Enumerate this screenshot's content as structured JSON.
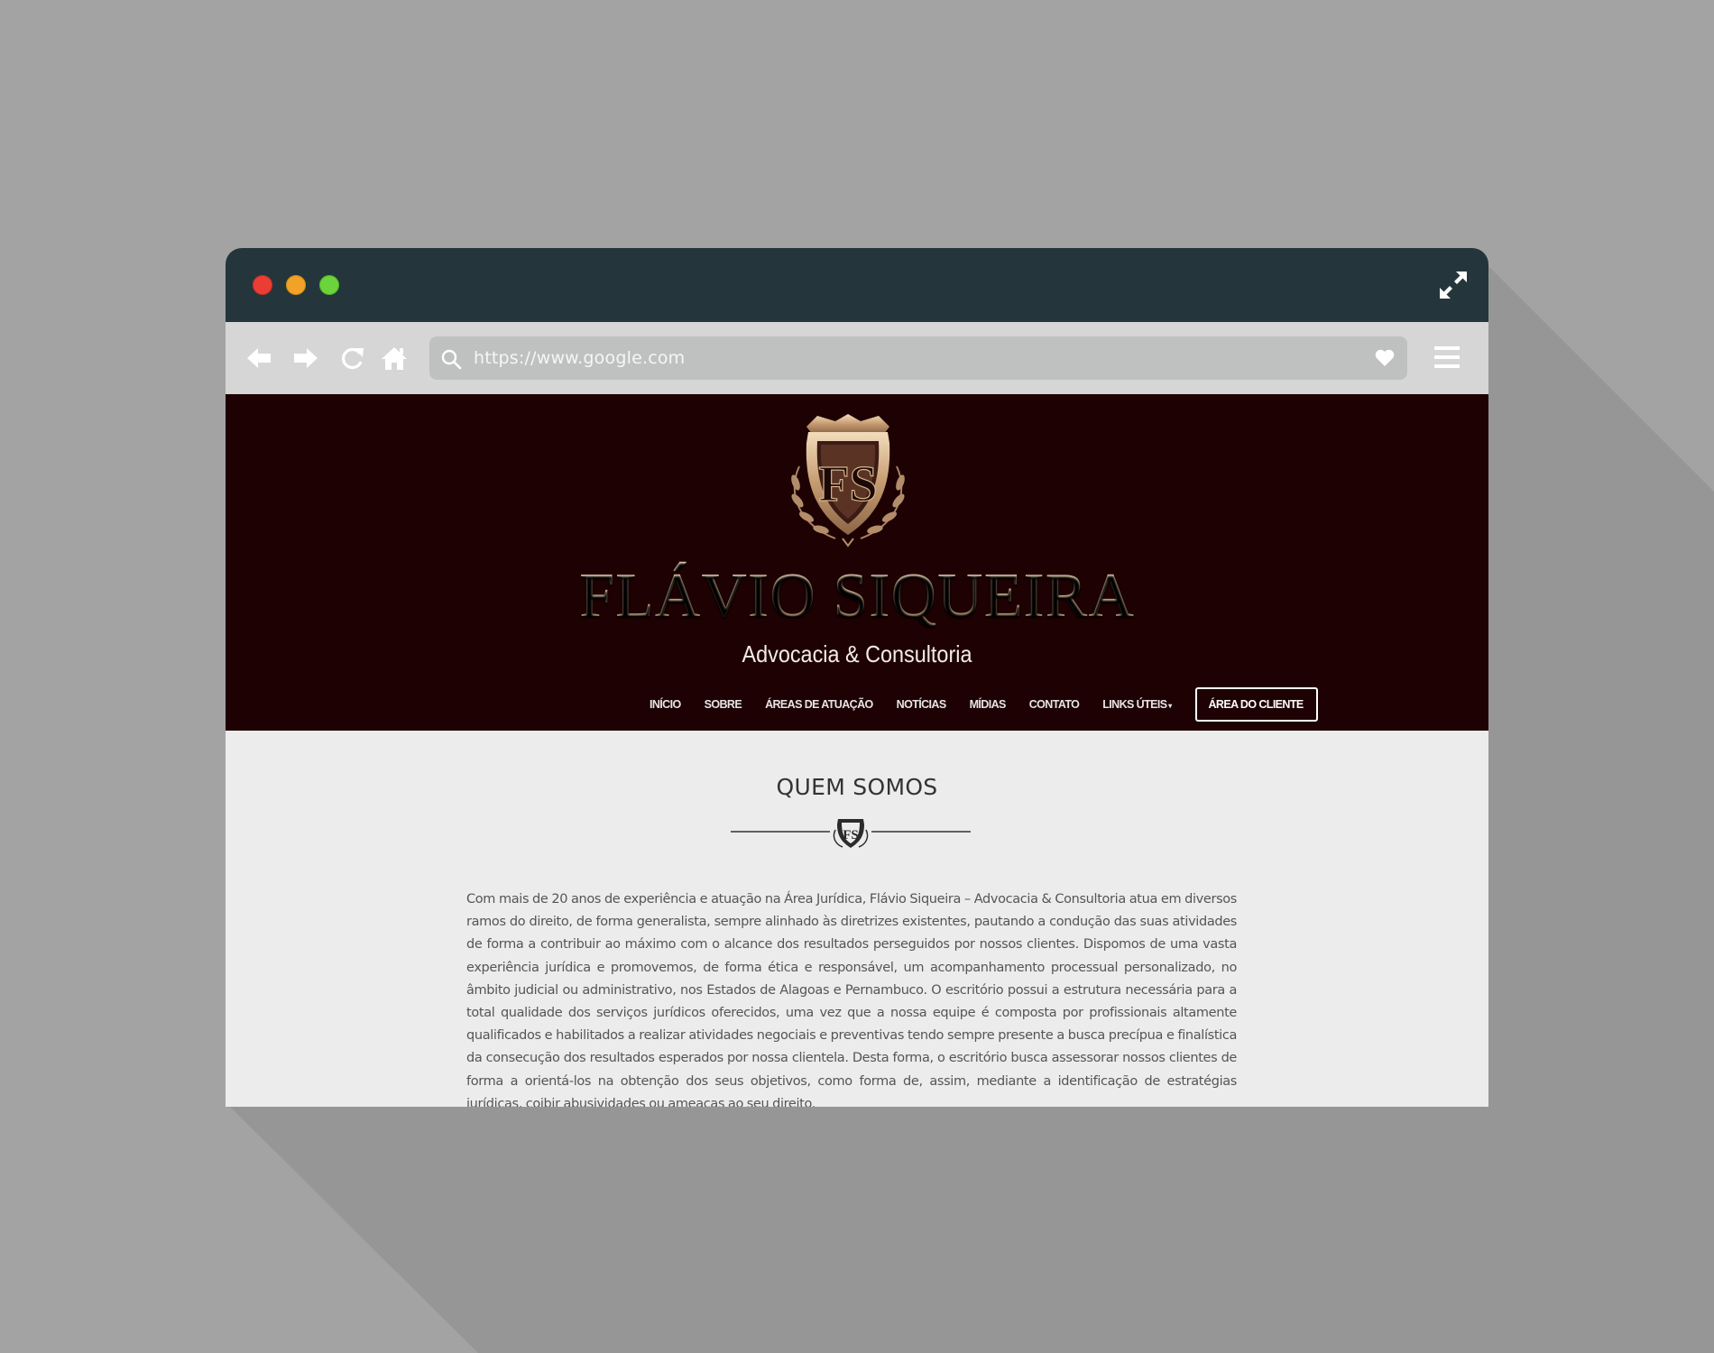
{
  "browser": {
    "url": "https://www.google.com"
  },
  "site": {
    "brand_name": "FLÁVIO SIQUEIRA",
    "brand_subtitle": "Advocacia & Consultoria",
    "logo_monogram": "FS",
    "nav": [
      {
        "label": "INÍCIO"
      },
      {
        "label": "SOBRE"
      },
      {
        "label": "ÁREAS DE ATUAÇÃO"
      },
      {
        "label": "NOTÍCIAS"
      },
      {
        "label": "MÍDIAS"
      },
      {
        "label": "CONTATO"
      },
      {
        "label": "LINKS ÚTEIS"
      }
    ],
    "cta_label": "ÁREA DO CLIENTE"
  },
  "section": {
    "title": "QUEM SOMOS",
    "body": "Com mais de 20 anos de experiência e atuação na Área Jurídica, Flávio Siqueira – Advocacia & Consultoria atua em diversos ramos do direito, de forma generalista, sempre alinhado às diretrizes existentes, pautando a condução das suas atividades de forma a contribuir ao máximo com o alcance dos resultados perseguidos por nossos clientes. Dispomos de uma vasta experiência jurídica e promovemos, de forma ética e responsável, um acompanhamento processual personalizado, no âmbito judicial ou administrativo, nos Estados de Alagoas e Pernambuco. O escritório possui a estrutura necessária para a total qualidade dos serviços jurídicos oferecidos, uma vez que a nossa equipe é composta por profissionais altamente qualificados e habilitados a realizar atividades negociais e preventivas tendo sempre presente a busca precípua e finalística da consecução dos resultados esperados por nossa clientela. Desta forma, o escritório busca assessorar nossos clientes de forma a orientá-los na obtenção dos seus objetivos, como forma de, assim, mediante a identificação de estratégias jurídicas, coibir abusividades ou ameaças ao seu direito."
  },
  "colors": {
    "page_bg": "#a3a3a3",
    "titlebar": "#24363b",
    "toolbar": "#d6d6d6",
    "header_bg": "#1e0203",
    "gold": "#c9a57c",
    "content_bg": "#ececec"
  },
  "icons": [
    "expand-icon",
    "back-arrow-icon",
    "forward-arrow-icon",
    "reload-icon",
    "home-icon",
    "search-icon",
    "heart-icon",
    "hamburger-menu-icon",
    "crest-logo-icon"
  ]
}
